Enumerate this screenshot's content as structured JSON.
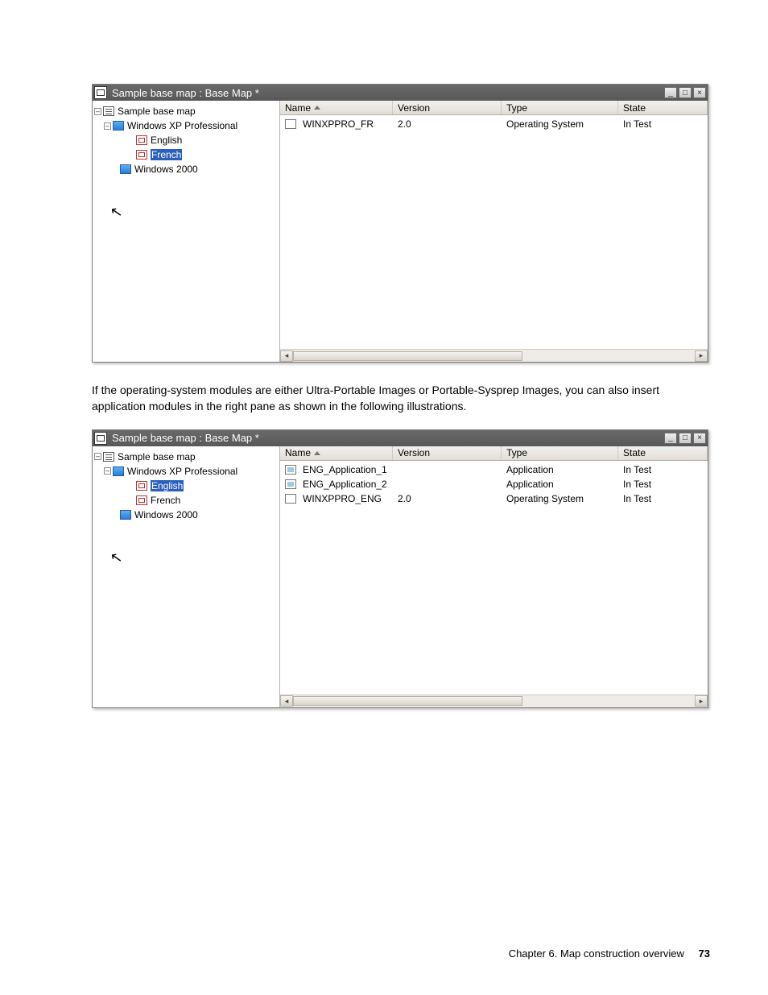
{
  "window1": {
    "title": "Sample base map : Base Map *",
    "tree": {
      "root": "Sample base map",
      "os1": "Windows XP Professional",
      "lang_en": "English",
      "lang_fr": "French",
      "os2": "Windows 2000",
      "selected": "French"
    },
    "columns": {
      "name": "Name",
      "version": "Version",
      "type": "Type",
      "state": "State"
    },
    "rows": [
      {
        "name": "WINXPPRO_FR",
        "version": "2.0",
        "type": "Operating System",
        "state": "In Test",
        "icon": "flag"
      }
    ]
  },
  "paragraph": "If the operating-system modules are either Ultra-Portable Images or Portable-Sysprep Images, you can also insert application modules in the right pane as shown in the following illustrations.",
  "window2": {
    "title": "Sample base map : Base Map *",
    "tree": {
      "root": "Sample base map",
      "os1": "Windows XP Professional",
      "lang_en": "English",
      "lang_fr": "French",
      "os2": "Windows 2000",
      "selected": "English"
    },
    "columns": {
      "name": "Name",
      "version": "Version",
      "type": "Type",
      "state": "State"
    },
    "rows": [
      {
        "name": "ENG_Application_1",
        "version": "",
        "type": "Application",
        "state": "In Test",
        "icon": "app"
      },
      {
        "name": "ENG_Application_2",
        "version": "",
        "type": "Application",
        "state": "In Test",
        "icon": "app"
      },
      {
        "name": "WINXPPRO_ENG",
        "version": "2.0",
        "type": "Operating System",
        "state": "In Test",
        "icon": "flag"
      }
    ]
  },
  "footer": {
    "chapter": "Chapter 6.  Map construction overview",
    "page": "73"
  },
  "glyphs": {
    "minus": "–",
    "min": "_",
    "max": "□",
    "close": "×",
    "left": "◂",
    "right": "▸",
    "cursor": "↖"
  }
}
